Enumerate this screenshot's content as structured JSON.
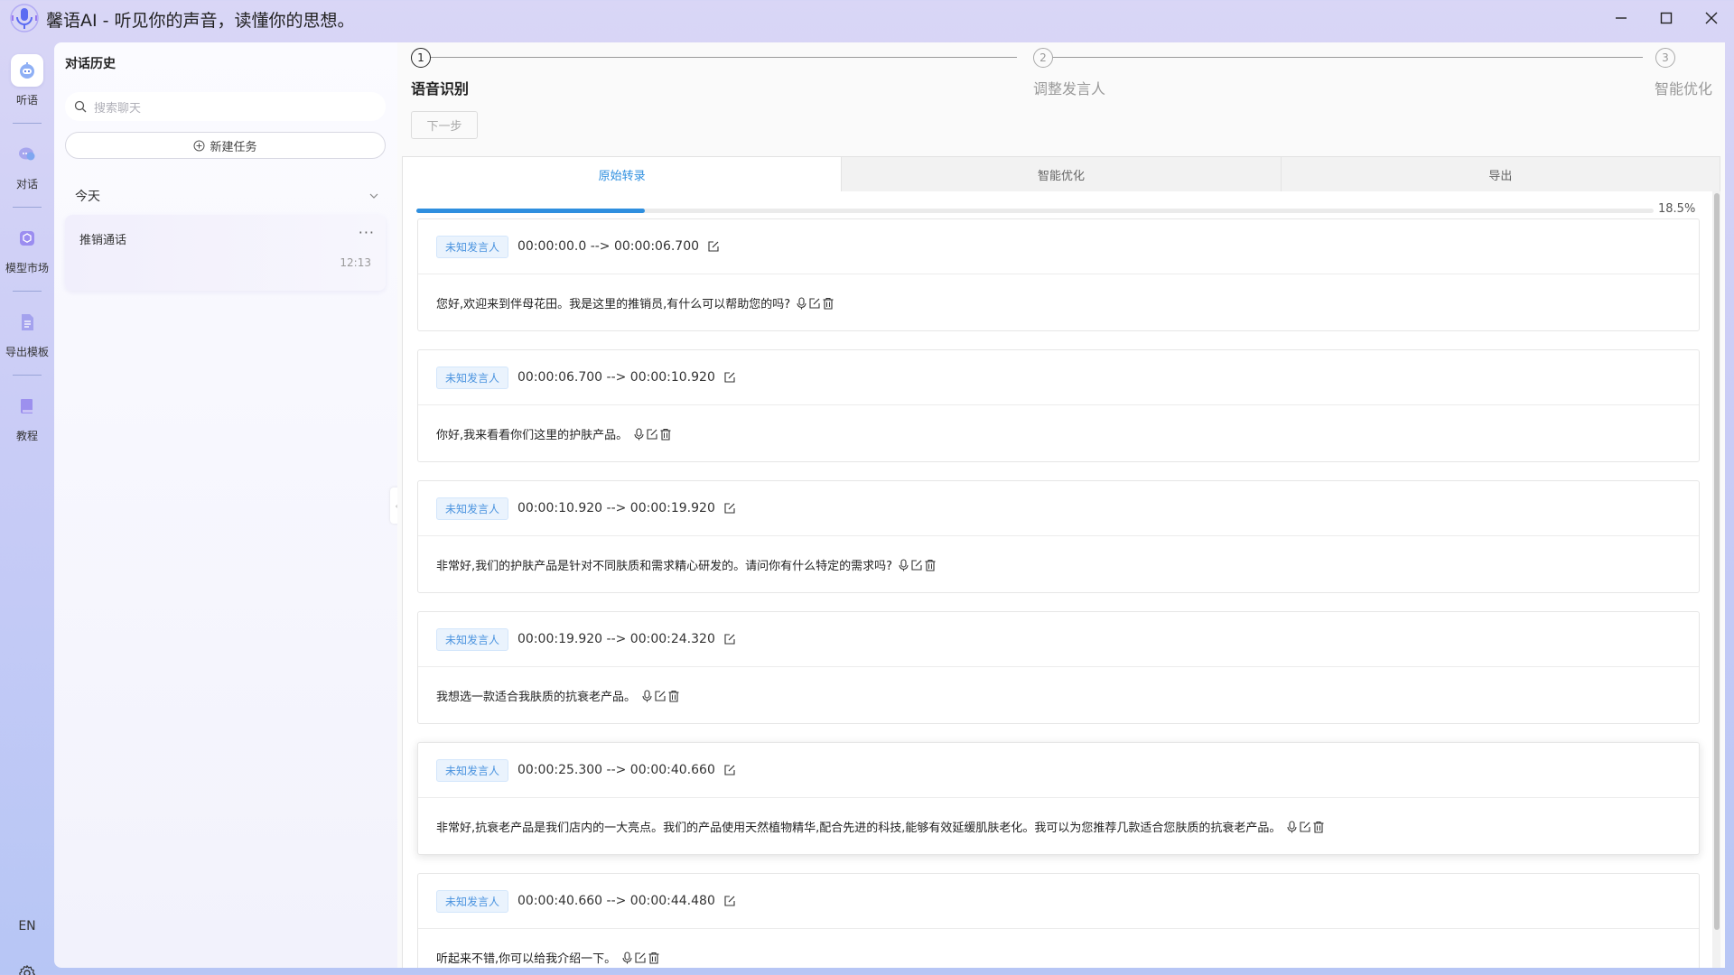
{
  "app": {
    "title": "馨语AI - 听见你的声音，读懂你的思想。"
  },
  "rail": {
    "items": [
      {
        "label": "听语",
        "icon": "robot-icon",
        "active": true
      },
      {
        "label": "对话",
        "icon": "chat-icon",
        "active": false
      },
      {
        "label": "模型市场",
        "icon": "cube-icon",
        "active": false
      },
      {
        "label": "导出模板",
        "icon": "document-icon",
        "active": false
      },
      {
        "label": "教程",
        "icon": "book-icon",
        "active": false
      }
    ],
    "language": "EN"
  },
  "sidebar": {
    "title": "对话历史",
    "search_placeholder": "搜索聊天",
    "new_task": "新建任务",
    "group_label": "今天",
    "conversations": [
      {
        "title": "推销通话",
        "time": "12:13"
      }
    ]
  },
  "steps": [
    {
      "num": "1",
      "label": "语音识别",
      "active": true
    },
    {
      "num": "2",
      "label": "调整发言人",
      "active": false
    },
    {
      "num": "3",
      "label": "智能优化",
      "active": false
    }
  ],
  "next_button": "下一步",
  "tabs": [
    {
      "label": "原始转录",
      "active": true
    },
    {
      "label": "智能优化",
      "active": false
    },
    {
      "label": "导出",
      "active": false
    }
  ],
  "progress": {
    "value": 0.185,
    "label": "18.5%"
  },
  "segments": [
    {
      "speaker": "未知发言人",
      "time": "00:00:00.0 --> 00:00:06.700",
      "text": "您好,欢迎来到伴母花田。我是这里的推销员,有什么可以帮助您的吗?"
    },
    {
      "speaker": "未知发言人",
      "time": "00:00:06.700 --> 00:00:10.920",
      "text": "你好,我来看看你们这里的护肤产品。"
    },
    {
      "speaker": "未知发言人",
      "time": "00:00:10.920 --> 00:00:19.920",
      "text": "非常好,我们的护肤产品是针对不同肤质和需求精心研发的。请问你有什么特定的需求吗?"
    },
    {
      "speaker": "未知发言人",
      "time": "00:00:19.920 --> 00:00:24.320",
      "text": "我想选一款适合我肤质的抗衰老产品。"
    },
    {
      "speaker": "未知发言人",
      "time": "00:00:25.300 --> 00:00:40.660",
      "text": "非常好,抗衰老产品是我们店内的一大亮点。我们的产品使用天然植物精华,配合先进的科技,能够有效延缓肌肤老化。我可以为您推荐几款适合您肤质的抗衰老产品。",
      "raised": true
    },
    {
      "speaker": "未知发言人",
      "time": "00:00:40.660 --> 00:00:44.480",
      "text": "听起来不错,你可以给我介绍一下。"
    }
  ],
  "colors": {
    "accent": "#2f8fdf",
    "speaker_badge": "#eaf3fd",
    "rail_gradient_top": "#d9d6f6",
    "rail_gradient_bottom": "#b7c6f5"
  }
}
